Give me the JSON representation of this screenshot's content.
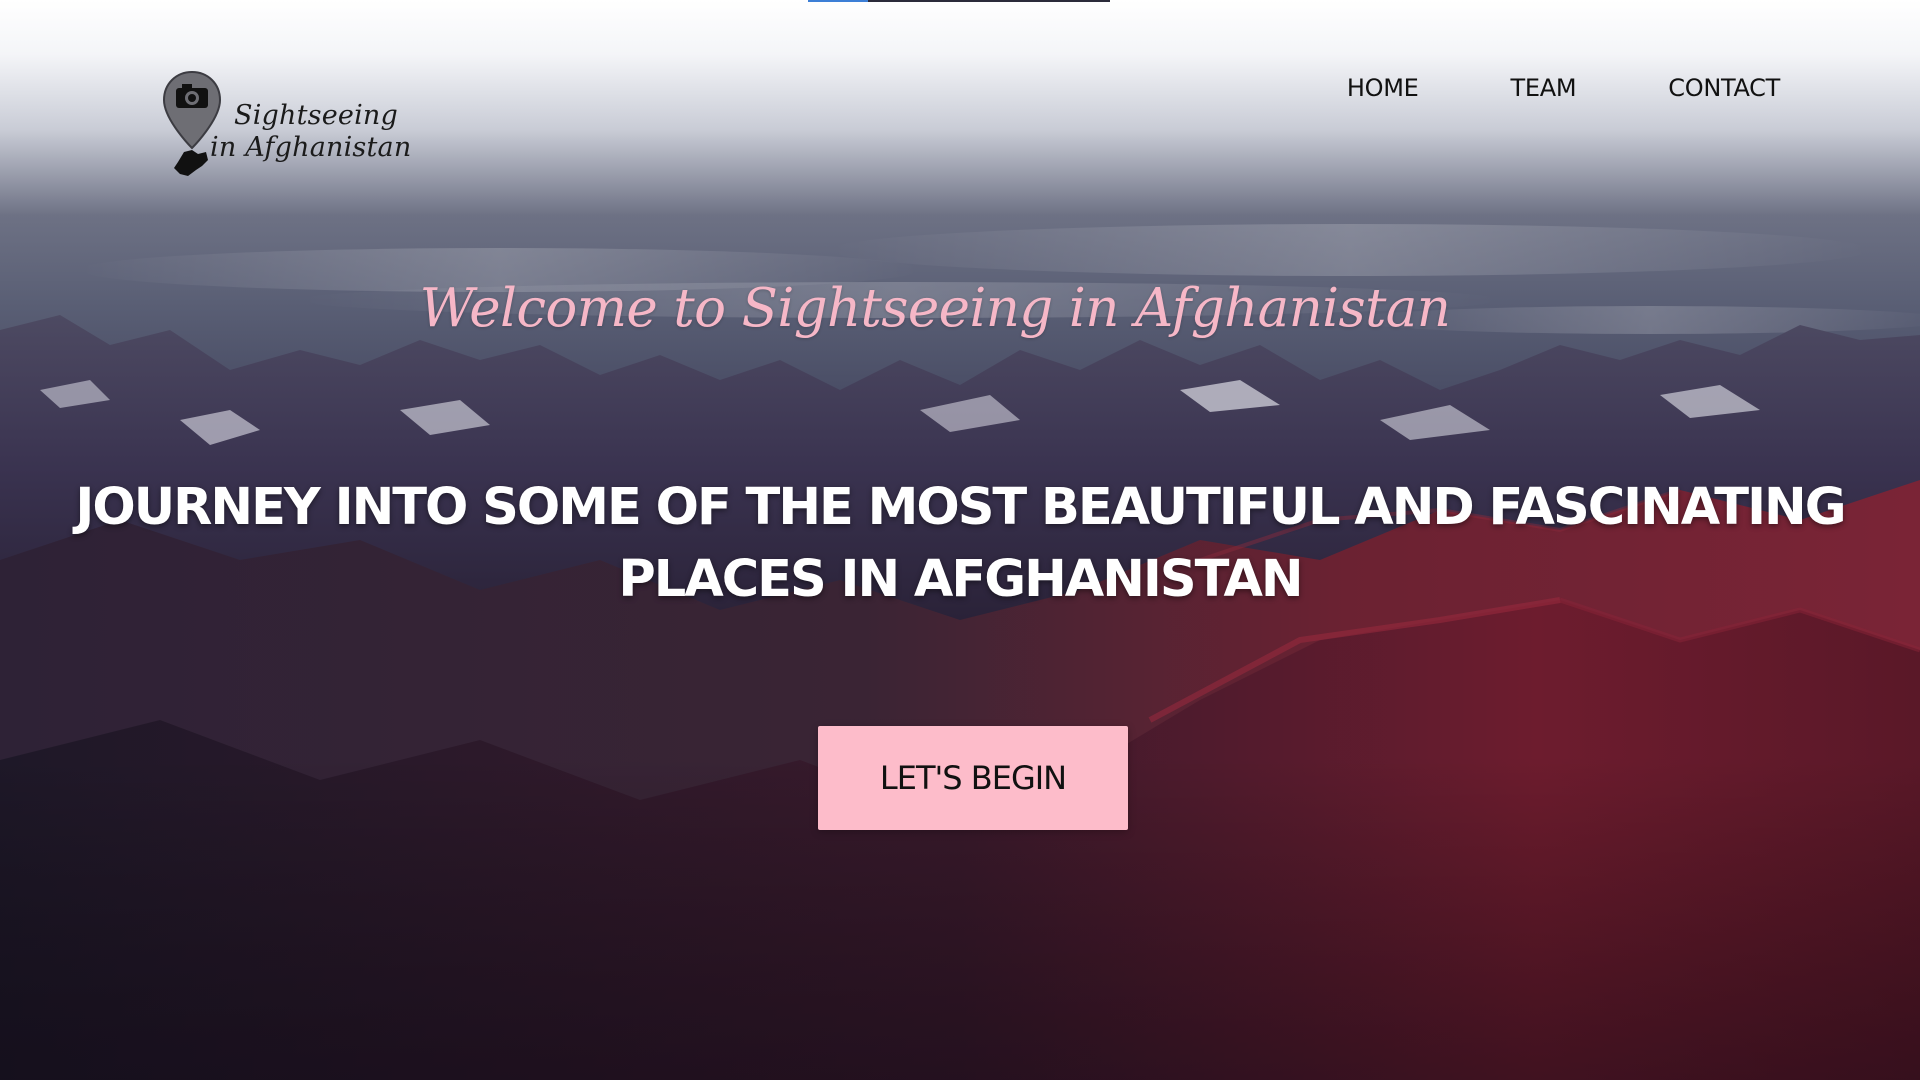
{
  "brand": {
    "line1": "Sightseeing",
    "line2": "in Afghanistan"
  },
  "nav": {
    "items": [
      {
        "label": "HOME"
      },
      {
        "label": "TEAM"
      },
      {
        "label": "CONTACT"
      }
    ]
  },
  "hero": {
    "welcome": "Welcome to Sightseeing in Afghanistan",
    "headline_line1": "JOURNEY INTO SOME OF THE MOST BEAUTIFUL AND FASCINATING",
    "headline_line2": "PLACES IN AFGHANISTAN",
    "cta_label": "LET'S BEGIN",
    "background": "mountain-range-photo"
  },
  "page_load_progress": 0.2,
  "colors": {
    "accent_pink": "#fdbcca",
    "welcome_pink": "#f6b7c7",
    "headline": "#ffffff",
    "nav_text": "#111111"
  }
}
